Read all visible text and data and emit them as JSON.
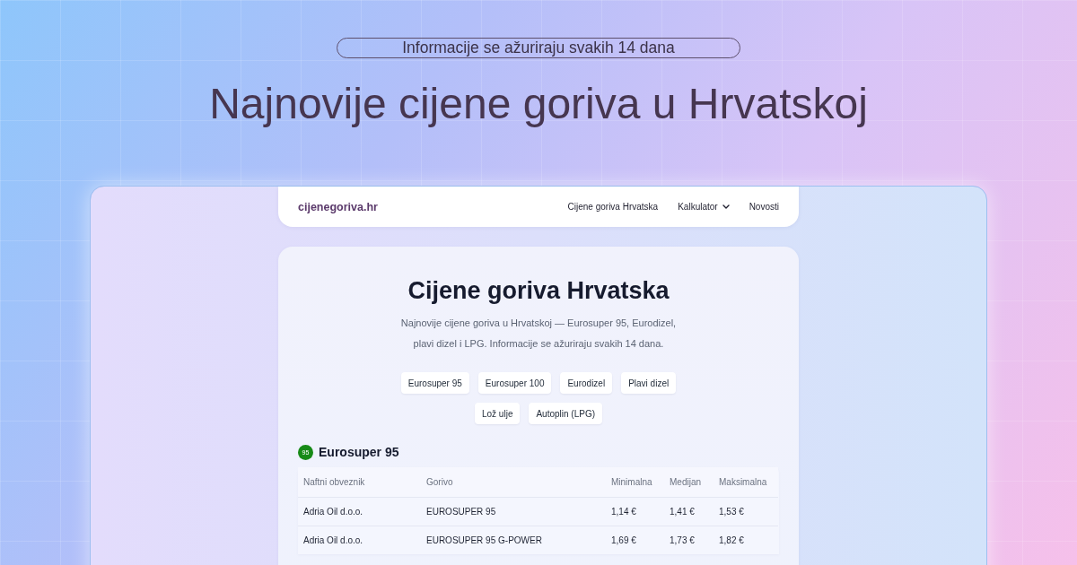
{
  "banner": {
    "badge": "Informacije se ažuriraju svakih 14 dana",
    "headline": "Najnovije cijene goriva u Hrvatskoj"
  },
  "site": {
    "nav": {
      "logo": "cijenegoriva.hr",
      "links": [
        {
          "label": "Cijene goriva Hrvatska",
          "kind": "link"
        },
        {
          "label": "Kalkulator",
          "kind": "dropdown"
        },
        {
          "label": "Novosti",
          "kind": "link"
        }
      ]
    },
    "hero": {
      "title": "Cijene goriva Hrvatska",
      "description": "Najnovije cijene goriva u Hrvatskoj — Eurosuper 95, Eurodizel, plavi dizel i LPG. Informacije se ažuriraju svakih 14 dana.",
      "fuel_filters": [
        "Eurosuper 95",
        "Eurosuper 100",
        "Eurodizel",
        "Plavi dizel",
        "Lož ulje",
        "Autoplin (LPG)"
      ]
    },
    "section": {
      "badge": "95",
      "title": "Eurosuper 95",
      "table": {
        "columns": [
          "Naftni obveznik",
          "Gorivo",
          "Minimalna",
          "Medijan",
          "Maksimalna"
        ],
        "rows": [
          [
            "Adria Oil d.o.o.",
            "EUROSUPER 95",
            "1,14 €",
            "1,41 €",
            "1,53 €"
          ],
          [
            "Adria Oil d.o.o.",
            "EUROSUPER 95 G-POWER",
            "1,69 €",
            "1,73 €",
            "1,82 €"
          ]
        ]
      }
    }
  }
}
